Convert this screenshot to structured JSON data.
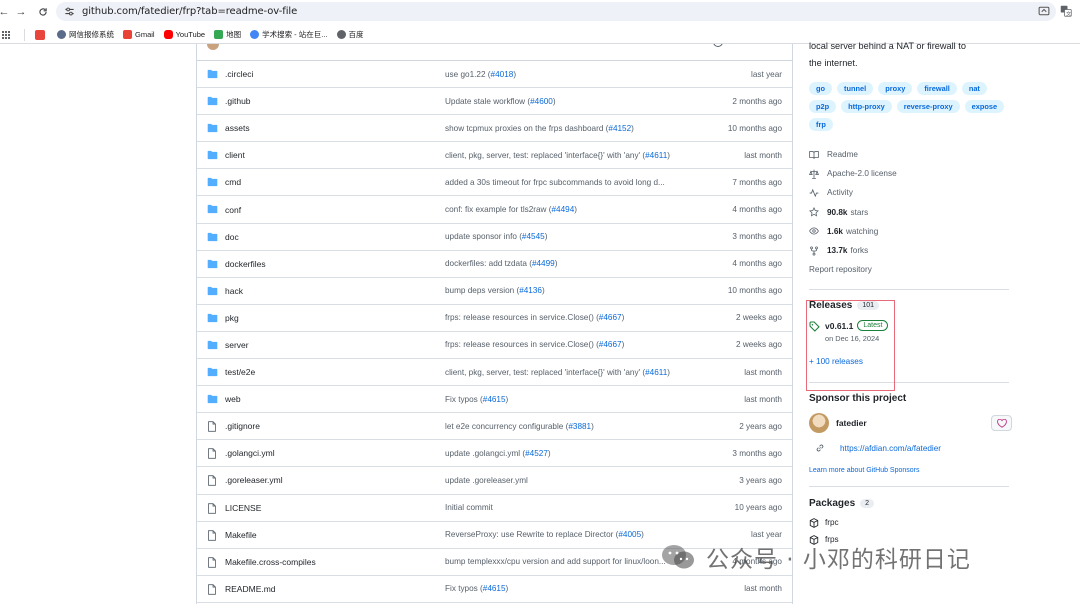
{
  "browser": {
    "url": "github.com/fatedier/frp?tab=readme-ov-file",
    "bookmarks": [
      {
        "label": "网信报修系统",
        "color": "#5b6b8a"
      },
      {
        "label": "Gmail",
        "color": "#ea4335"
      },
      {
        "label": "YouTube",
        "color": "#ff0000"
      },
      {
        "label": "地图",
        "color": "#34a853"
      },
      {
        "label": "学术搜索 - 站在巨...",
        "color": "#4285f4"
      },
      {
        "label": "百度",
        "color": "#5f6368"
      }
    ]
  },
  "files": [
    {
      "type": "dir",
      "name": ".circleci",
      "msg": "use go1.22 (",
      "pr": "#4018",
      "msg_after": ")",
      "date": "last year"
    },
    {
      "type": "dir",
      "name": ".github",
      "msg": "Update stale workflow (",
      "pr": "#4600",
      "msg_after": ")",
      "date": "2 months ago"
    },
    {
      "type": "dir",
      "name": "assets",
      "msg": "show tcpmux proxies on the frps dashboard (",
      "pr": "#4152",
      "msg_after": ")",
      "date": "10 months ago"
    },
    {
      "type": "dir",
      "name": "client",
      "msg": "client, pkg, server, test: replaced 'interface{}' with 'any' (",
      "pr": "#4611",
      "msg_after": ")",
      "date": "last month"
    },
    {
      "type": "dir",
      "name": "cmd",
      "msg": "added a 30s timeout for frpc subcommands to avoid long d...",
      "pr": "",
      "msg_after": "",
      "date": "7 months ago"
    },
    {
      "type": "dir",
      "name": "conf",
      "msg": "conf: fix example for tls2raw (",
      "pr": "#4494",
      "msg_after": ")",
      "date": "4 months ago"
    },
    {
      "type": "dir",
      "name": "doc",
      "msg": "update sponsor info (",
      "pr": "#4545",
      "msg_after": ")",
      "date": "3 months ago"
    },
    {
      "type": "dir",
      "name": "dockerfiles",
      "msg": "dockerfiles: add tzdata (",
      "pr": "#4499",
      "msg_after": ")",
      "date": "4 months ago"
    },
    {
      "type": "dir",
      "name": "hack",
      "msg": "bump deps version (",
      "pr": "#4136",
      "msg_after": ")",
      "date": "10 months ago"
    },
    {
      "type": "dir",
      "name": "pkg",
      "msg": "frps: release resources in service.Close() (",
      "pr": "#4667",
      "msg_after": ")",
      "date": "2 weeks ago"
    },
    {
      "type": "dir",
      "name": "server",
      "msg": "frps: release resources in service.Close() (",
      "pr": "#4667",
      "msg_after": ")",
      "date": "2 weeks ago"
    },
    {
      "type": "dir",
      "name": "test/e2e",
      "msg": "client, pkg, server, test: replaced 'interface{}' with 'any' (",
      "pr": "#4611",
      "msg_after": ")",
      "date": "last month"
    },
    {
      "type": "dir",
      "name": "web",
      "msg": "Fix typos (",
      "pr": "#4615",
      "msg_after": ")",
      "date": "last month"
    },
    {
      "type": "file",
      "name": ".gitignore",
      "msg": "let e2e concurrency configurable (",
      "pr": "#3881",
      "msg_after": ")",
      "date": "2 years ago"
    },
    {
      "type": "file",
      "name": ".golangci.yml",
      "msg": "update .golangci.yml (",
      "pr": "#4527",
      "msg_after": ")",
      "date": "3 months ago"
    },
    {
      "type": "file",
      "name": ".goreleaser.yml",
      "msg": "update .goreleaser.yml",
      "pr": "",
      "msg_after": "",
      "date": "3 years ago"
    },
    {
      "type": "file",
      "name": "LICENSE",
      "msg": "Initial commit",
      "pr": "",
      "msg_after": "",
      "date": "10 years ago"
    },
    {
      "type": "file",
      "name": "Makefile",
      "msg": "ReverseProxy: use Rewrite to replace Director (",
      "pr": "#4005",
      "msg_after": ")",
      "date": "last year"
    },
    {
      "type": "file",
      "name": "Makefile.cross-compiles",
      "msg": "bump templexxx/cpu version and add support for linux/loon...",
      "pr": "",
      "msg_after": "",
      "date": "4 months ago"
    },
    {
      "type": "file",
      "name": "README.md",
      "msg": "Fix typos (",
      "pr": "#4615",
      "msg_after": ")",
      "date": "last month"
    }
  ],
  "about": {
    "description_line1": "local server behind a NAT or firewall to",
    "description_line2": "the internet.",
    "topics": [
      "go",
      "tunnel",
      "proxy",
      "firewall",
      "nat",
      "p2p",
      "http-proxy",
      "reverse-proxy",
      "expose",
      "frp"
    ],
    "readme": "Readme",
    "license": "Apache-2.0 license",
    "activity": "Activity",
    "stars_count": "90.8k",
    "stars_label": "stars",
    "watching_count": "1.6k",
    "watching_label": "watching",
    "forks_count": "13.7k",
    "forks_label": "forks",
    "report": "Report repository"
  },
  "releases": {
    "title": "Releases",
    "count": "101",
    "latest_version": "v0.61.1",
    "latest_badge": "Latest",
    "latest_date": "on Dec 16, 2024",
    "more": "+ 100 releases"
  },
  "sponsor": {
    "title": "Sponsor this project",
    "user": "fatedier",
    "link": "https://afdian.com/a/fatedier",
    "learn_more": "Learn more about GitHub Sponsors"
  },
  "packages": {
    "title": "Packages",
    "count": "2",
    "items": [
      "frpc",
      "frps"
    ]
  },
  "watermark": {
    "text": "公众号 · 小邓的科研日记"
  },
  "colors": {
    "link": "#0969da",
    "folder": "#54aeff",
    "latest_green": "#1a7f37",
    "highlight_box": "#e86a78"
  }
}
